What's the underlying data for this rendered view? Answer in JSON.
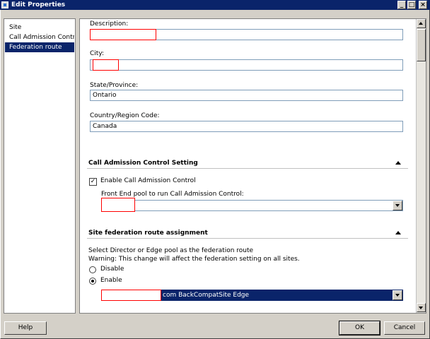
{
  "window": {
    "title": "Edit Properties",
    "minimize": "_",
    "maximize": "□",
    "close": "×"
  },
  "nav": {
    "items": [
      {
        "label": "Site"
      },
      {
        "label": "Call Admission Control"
      },
      {
        "label": "Federation route"
      }
    ]
  },
  "form": {
    "description_label": "Description:",
    "description_value": "",
    "city_label": "City:",
    "city_value": "",
    "state_label": "State/Province:",
    "state_value": "Ontario",
    "country_label": "Country/Region Code:",
    "country_value": "Canada"
  },
  "cac": {
    "header": "Call Admission Control Setting",
    "enable_label": "Enable Call Admission Control",
    "enable_checked_glyph": "✓",
    "pool_label": "Front End pool to run Call Admission Control:",
    "pool_value": ""
  },
  "federation": {
    "header": "Site federation route assignment",
    "instruction": "Select Director or Edge pool as the federation route",
    "warning": "Warning: This change will affect the federation setting on all sites.",
    "disable_label": "Disable",
    "enable_label": "Enable",
    "route_value": "com   BackCompatSite   Edge"
  },
  "footer": {
    "help": "Help",
    "ok": "OK",
    "cancel": "Cancel"
  }
}
